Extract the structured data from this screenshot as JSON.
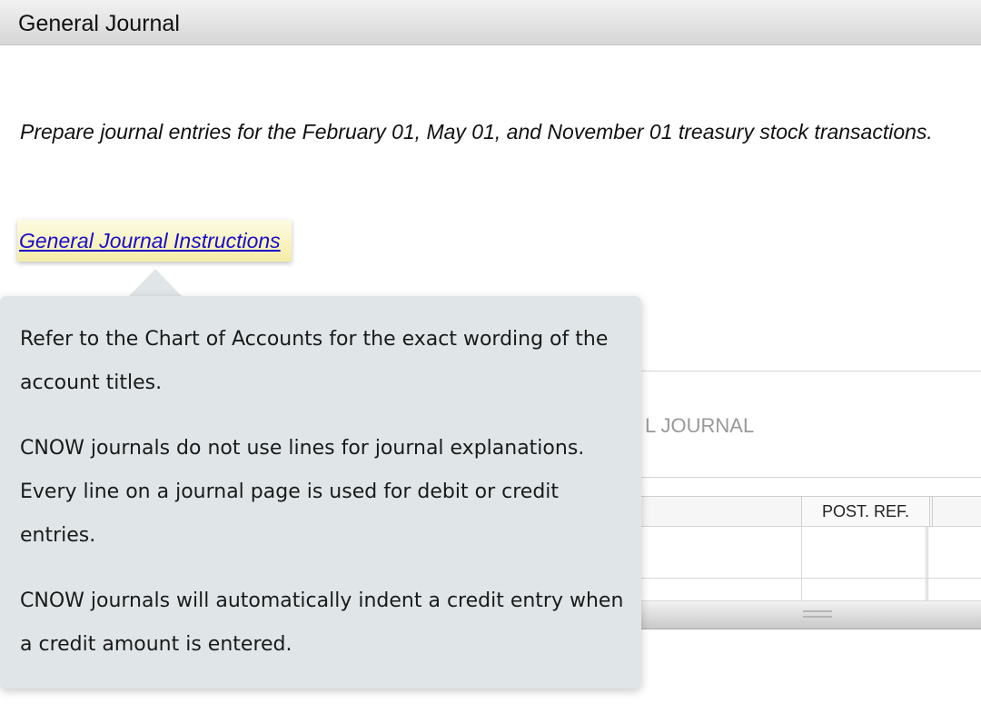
{
  "header": {
    "title": "General Journal"
  },
  "instruction_text": "Prepare journal entries for the February 01, May 01, and November 01 treasury stock transactions.",
  "help_link": {
    "label": "General Journal Instructions"
  },
  "popover": {
    "paragraphs": [
      "Refer to the Chart of Accounts for the exact wording of the account titles.",
      "CNOW journals do not use lines for journal explanations. Every line on a journal page is used for debit or credit entries.",
      "CNOW journals will automatically indent a credit entry when a credit amount is entered."
    ]
  },
  "journal": {
    "title_visible": "L JOURNAL",
    "columns": {
      "post_ref": "POST. REF."
    }
  },
  "colors": {
    "popover_bg": "#e0e6e8",
    "link": "#1a0dcc",
    "link_highlight": "#f4eca6"
  }
}
